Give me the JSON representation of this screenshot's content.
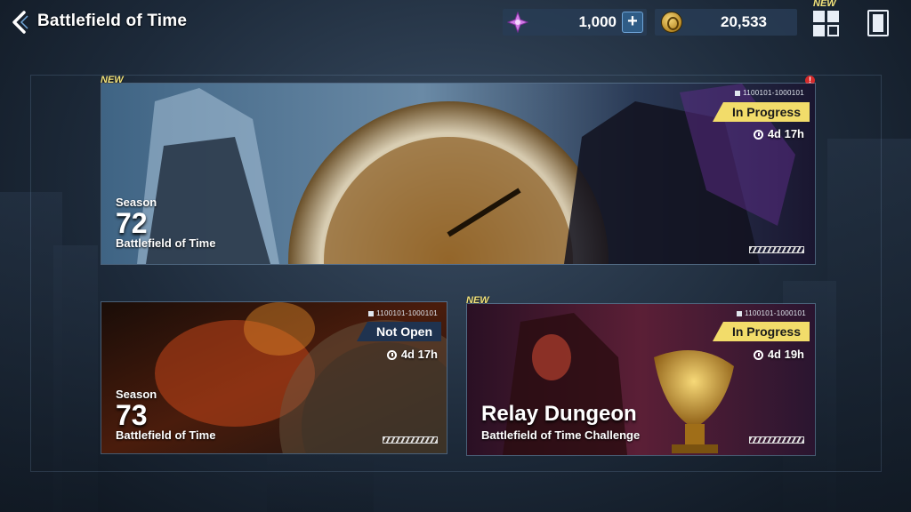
{
  "header": {
    "title": "Battlefield of Time"
  },
  "resources": {
    "gems": {
      "icon": "purple-crystal-icon",
      "value": "1,000"
    },
    "coins": {
      "icon": "gold-coin-icon",
      "value": "20,533"
    }
  },
  "menu": {
    "new_label": "NEW"
  },
  "cards": [
    {
      "new_label": "NEW",
      "code": "1100101-1000101",
      "status": "In Progress",
      "timer": "4d 17h",
      "season_word": "Season",
      "season_number": "72",
      "subtitle": "Battlefield of Time",
      "alert": "!"
    },
    {
      "code": "1100101-1000101",
      "status": "Not Open",
      "timer": "4d 17h",
      "season_word": "Season",
      "season_number": "73",
      "subtitle": "Battlefield of Time"
    },
    {
      "new_label": "NEW",
      "code": "1100101-1000101",
      "status": "In Progress",
      "timer": "4d 19h",
      "title": "Relay Dungeon",
      "subtitle": "Battlefield of Time Challenge"
    }
  ],
  "colors": {
    "status_active": "#f2dc6a",
    "status_inactive": "#1f3350",
    "new_tag": "#f2e27a",
    "alert": "#d52a2a"
  }
}
